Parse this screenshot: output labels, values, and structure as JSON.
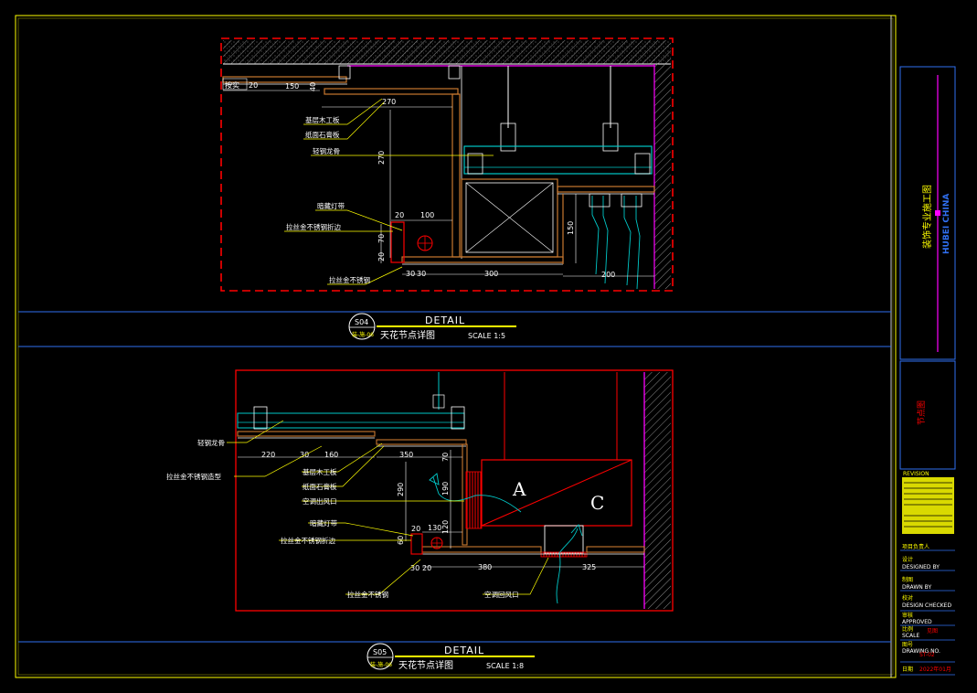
{
  "colors": {
    "frame": "#ffff00",
    "band": "#2f6ff0",
    "red": "#ff0000",
    "white": "#ffffff",
    "cyan": "#00c8c8",
    "brown": "#c87830",
    "magenta": "#ff00ff",
    "green": "#00b400",
    "hatch": "#9a9a9a"
  },
  "detail_s04": {
    "dims": [
      "20",
      "150",
      "40",
      "270",
      "270",
      "20",
      "100",
      "70",
      "20",
      "30",
      "30",
      "300",
      "150",
      "200"
    ],
    "label_tag": "按实",
    "leaders": [
      "基层木工板",
      "纸面石膏板",
      "轻钢龙骨",
      "暗藏灯带",
      "拉丝金不锈钢折边",
      "拉丝金不锈钢"
    ],
    "bubble_id": "S04",
    "bubble_code": "装-施-06",
    "caption_title": "DETAIL",
    "caption_name": "天花节点详图",
    "caption_scale": "SCALE 1:5"
  },
  "detail_s05": {
    "dims": [
      "220",
      "30",
      "160",
      "350",
      "70",
      "190",
      "290",
      "130",
      "120",
      "60",
      "20",
      "30",
      "20",
      "380",
      "325"
    ],
    "leaders": [
      "轻钢龙骨",
      "拉丝金不锈钢造型",
      "基层木工板",
      "纸面石膏板",
      "空调出风口",
      "暗藏灯带",
      "拉丝金不锈钢折边",
      "拉丝金不锈钢",
      "空调回风口"
    ],
    "unit_labels": [
      "A",
      "C"
    ],
    "bubble_id": "S05",
    "bubble_code": "装-施-06",
    "caption_title": "DETAIL",
    "caption_name": "天花节点详图",
    "caption_scale": "SCALE 1:8"
  },
  "title_block": {
    "firm_cn": "装饰专业施工图",
    "firm_en": "HUBEI CHINA",
    "sheet_name": "节点图",
    "revision": "REVISION",
    "rows": [
      {
        "cn": "项目负责人",
        "en": ""
      },
      {
        "cn": "设计",
        "en": "DESIGNED BY"
      },
      {
        "cn": "制图",
        "en": "DRAWN BY"
      },
      {
        "cn": "校对",
        "en": "DESIGN CHECKED"
      },
      {
        "cn": "审核",
        "en": "APPROVED"
      },
      {
        "cn": "比例",
        "en": "SCALE",
        "value": "见图"
      },
      {
        "cn": "图号",
        "en": "DRAWING NO.",
        "value": "ST-02"
      },
      {
        "cn": "日期",
        "en": "",
        "value": "2022年01月"
      }
    ]
  }
}
